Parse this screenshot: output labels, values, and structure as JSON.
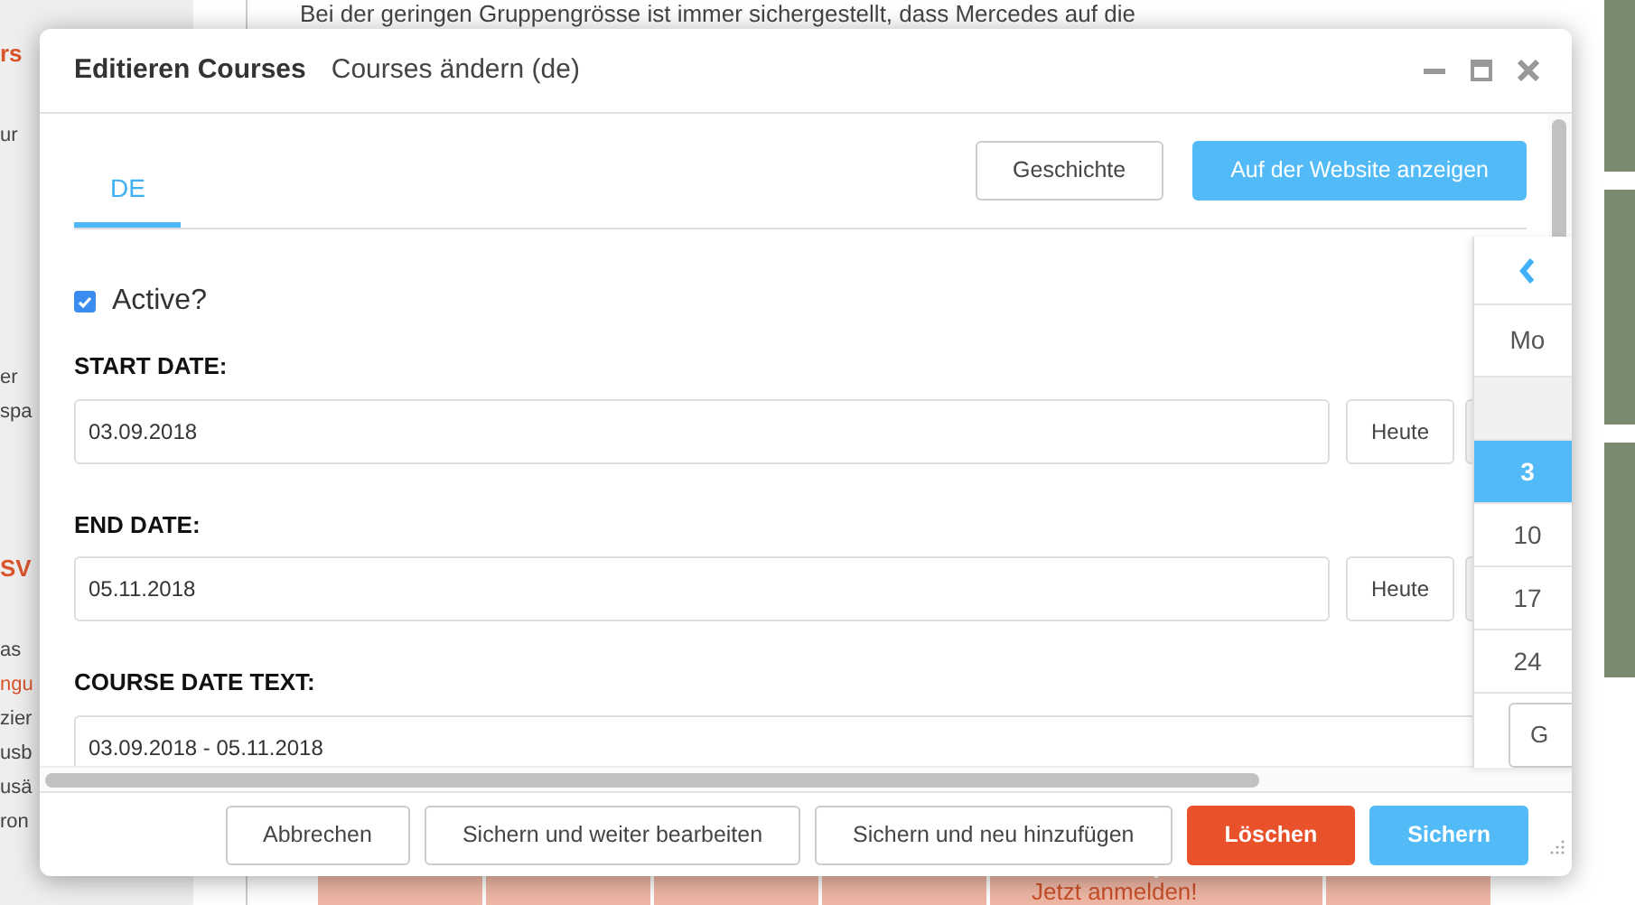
{
  "background": {
    "paragraph": "Bei der geringen Gruppengrösse ist immer sichergestellt, dass Mercedes auf die",
    "sidebar_blocks": [
      [
        {
          "text": "rs",
          "kind": "heading"
        },
        {
          "text": "ur",
          "kind": "text"
        }
      ],
      [
        {
          "text": "er",
          "kind": "text"
        },
        {
          "text": "spa",
          "kind": "text"
        }
      ],
      [
        {
          "text": "SV",
          "kind": "heading"
        },
        {
          "text": "as",
          "kind": "text"
        },
        {
          "text": "ngu",
          "kind": "link"
        },
        {
          "text": "zier",
          "kind": "text"
        },
        {
          "text": "usb",
          "kind": "text"
        },
        {
          "text": "usä",
          "kind": "text"
        },
        {
          "text": "ron",
          "kind": "text"
        }
      ]
    ],
    "table_link": "Jetzt anmelden!"
  },
  "dialog": {
    "title": "Editieren Courses",
    "subtitle": "Courses ändern (de)",
    "tabs": [
      {
        "label": "DE",
        "selected": true
      }
    ],
    "actions": [
      {
        "label": "Geschichte",
        "kind": "outline"
      },
      {
        "label": "Auf der Website anzeigen",
        "kind": "primary"
      }
    ],
    "fields": [
      {
        "kind": "checkbox",
        "label": "Active?",
        "checked": true
      },
      {
        "kind": "date",
        "label": "START DATE:",
        "value": "03.09.2018",
        "today": "Heute"
      },
      {
        "kind": "date",
        "label": "END DATE:",
        "value": "05.11.2018",
        "today": "Heute"
      },
      {
        "kind": "text",
        "label": "COURSE DATE TEXT:",
        "value": "03.09.2018 - 05.11.2018"
      }
    ],
    "datepicker": {
      "weekday": "Mo",
      "days": [
        {
          "label": "3",
          "selected": true
        },
        {
          "label": "10",
          "selected": false
        },
        {
          "label": "17",
          "selected": false
        },
        {
          "label": "24",
          "selected": false
        }
      ],
      "button": "G"
    },
    "footer_buttons": [
      {
        "label": "Abbrechen",
        "kind": "outline"
      },
      {
        "label": "Sichern und weiter bearbeiten",
        "kind": "outline"
      },
      {
        "label": "Sichern und neu hinzufügen",
        "kind": "outline"
      },
      {
        "label": "Löschen",
        "kind": "danger"
      },
      {
        "label": "Sichern",
        "kind": "primary"
      }
    ]
  }
}
